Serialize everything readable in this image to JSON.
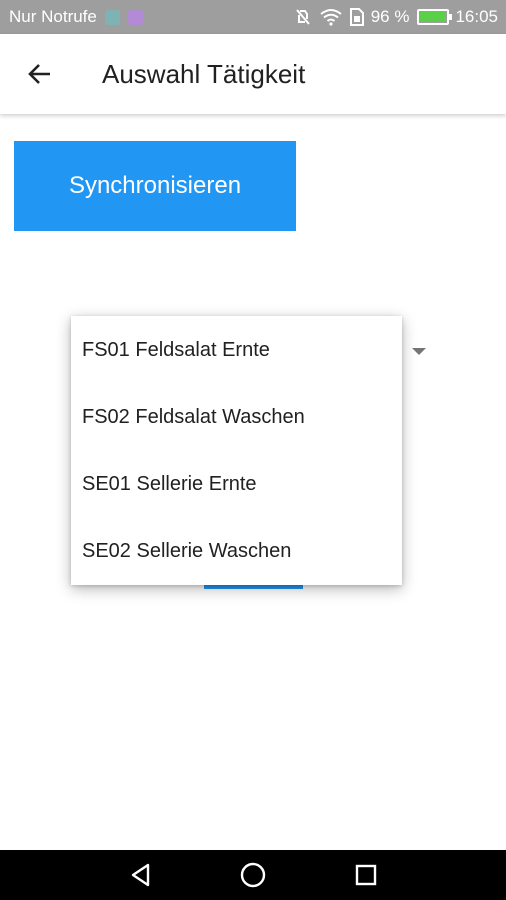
{
  "status_bar": {
    "carrier": "Nur Notrufe",
    "battery_text": "96 %",
    "battery_level": 0.96,
    "time": "16:05"
  },
  "app_bar": {
    "title": "Auswahl Tätigkeit",
    "back_icon": "arrow-left-icon"
  },
  "sync_button": {
    "label": "Synchronisieren"
  },
  "dropdown": {
    "items": [
      "FS01 Feldsalat Ernte",
      "FS02 Feldsalat Waschen",
      "SE01 Sellerie Ernte",
      "SE02 Sellerie Waschen"
    ]
  },
  "colors": {
    "accent": "#2196f3",
    "status_bar": "#9e9e9e",
    "nav_bar": "#000000"
  }
}
